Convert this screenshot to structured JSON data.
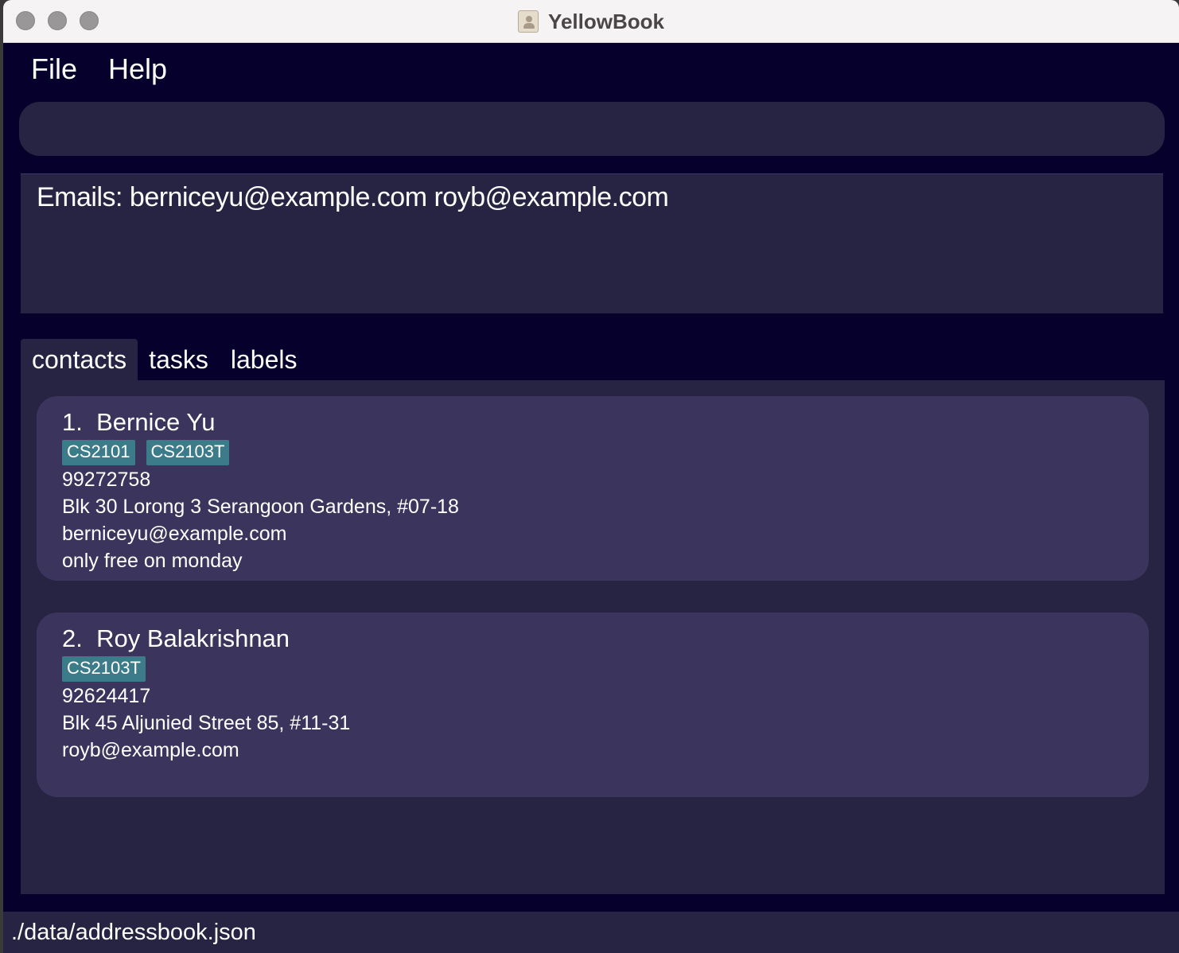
{
  "window": {
    "title": "YellowBook"
  },
  "menu": {
    "items": [
      {
        "label": "File"
      },
      {
        "label": "Help"
      }
    ]
  },
  "command_box": {
    "value": "",
    "placeholder": ""
  },
  "result_display": {
    "text": "Emails: berniceyu@example.com royb@example.com"
  },
  "tabs": [
    {
      "label": "contacts",
      "active": true
    },
    {
      "label": "tasks",
      "active": false
    },
    {
      "label": "labels",
      "active": false
    }
  ],
  "contacts": [
    {
      "index_name": "1.  Bernice Yu",
      "tags": [
        "CS2101",
        "CS2103T"
      ],
      "phone": "99272758",
      "address": "Blk 30 Lorong 3 Serangoon Gardens, #07-18",
      "email": "berniceyu@example.com",
      "remark": "only free on monday"
    },
    {
      "index_name": "2.  Roy Balakrishnan",
      "tags": [
        "CS2103T"
      ],
      "phone": "92624417",
      "address": "Blk 45 Aljunied Street 85, #11-31",
      "email": "royb@example.com",
      "remark": ""
    }
  ],
  "status_bar": {
    "path": "./data/addressbook.json"
  },
  "colors": {
    "background": "#05012c",
    "panel": "#272343",
    "card": "#3b345d",
    "tag": "#3b7b8a"
  }
}
